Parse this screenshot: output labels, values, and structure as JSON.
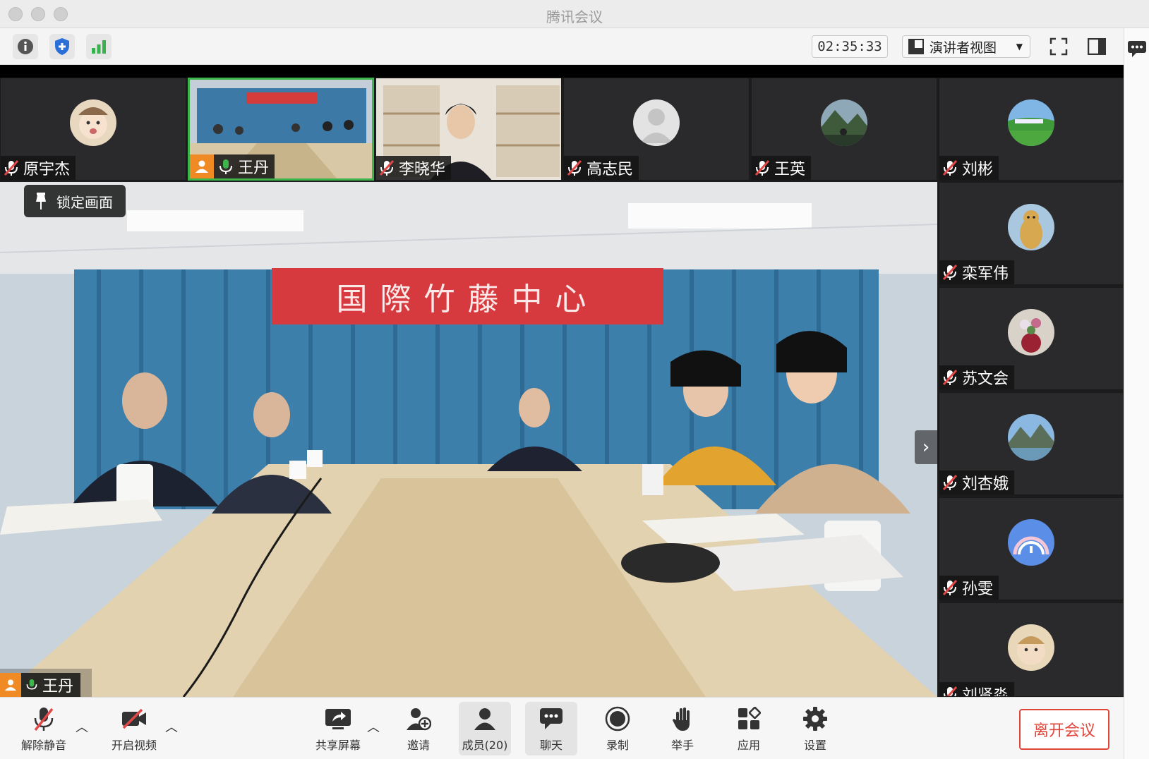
{
  "window": {
    "title": "腾讯会议"
  },
  "toolbar": {
    "timer": "02:35:33",
    "view_label": "演讲者视图"
  },
  "participants_top": [
    {
      "name": "原宇杰",
      "mic": "muted",
      "avatar": "child-photo"
    },
    {
      "name": "王丹",
      "mic": "on",
      "avatar": "video",
      "host": true,
      "speaking": true
    },
    {
      "name": "李晓华",
      "mic": "muted",
      "avatar": "video"
    },
    {
      "name": "高志民",
      "mic": "muted",
      "avatar": "default-person"
    },
    {
      "name": "王英",
      "mic": "muted",
      "avatar": "landscape-photo"
    },
    {
      "name": "刘彬",
      "mic": "muted",
      "avatar": "grassland-photo"
    }
  ],
  "participants_right": [
    {
      "name": "栾军伟",
      "mic": "muted",
      "avatar": "bear-photo"
    },
    {
      "name": "苏文会",
      "mic": "muted",
      "avatar": "flowers-photo"
    },
    {
      "name": "刘杏娥",
      "mic": "muted",
      "avatar": "mountain-photo"
    },
    {
      "name": "孙雯",
      "mic": "muted",
      "avatar": "rainbow-illustration"
    },
    {
      "name": "刘贤淼",
      "mic": "muted",
      "avatar": "child-photo"
    }
  ],
  "main_video": {
    "lock_label": "锁定画面",
    "banner_text": "国際竹藤中心",
    "speaker_name": "王丹"
  },
  "bottom": {
    "unmute": "解除静音",
    "start_video": "开启视频",
    "share_screen": "共享屏幕",
    "invite": "邀请",
    "members": "成员(20)",
    "chat": "聊天",
    "record": "录制",
    "raise_hand": "举手",
    "apps": "应用",
    "settings": "设置",
    "leave": "离开会议"
  },
  "colors": {
    "accent_green": "#3cb54a",
    "leave_red": "#e0453a",
    "mute_red": "#e04848"
  }
}
